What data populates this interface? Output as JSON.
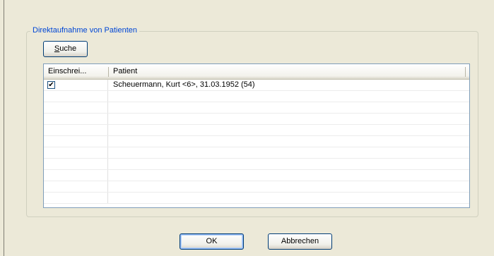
{
  "dialog": {
    "group_title": "Direktaufnahme von Patienten",
    "search_button": {
      "accel": "S",
      "rest": "uche"
    },
    "ok_label": "OK",
    "cancel_label": "Abbrechen"
  },
  "table": {
    "columns": [
      "Einschrei...",
      "Patient"
    ],
    "rows": [
      {
        "checked": true,
        "patient": "Scheuermann, Kurt <6>, 31.03.1952 (54)"
      }
    ],
    "empty_rows": 10
  },
  "icons": {
    "checkmark": "✔"
  }
}
